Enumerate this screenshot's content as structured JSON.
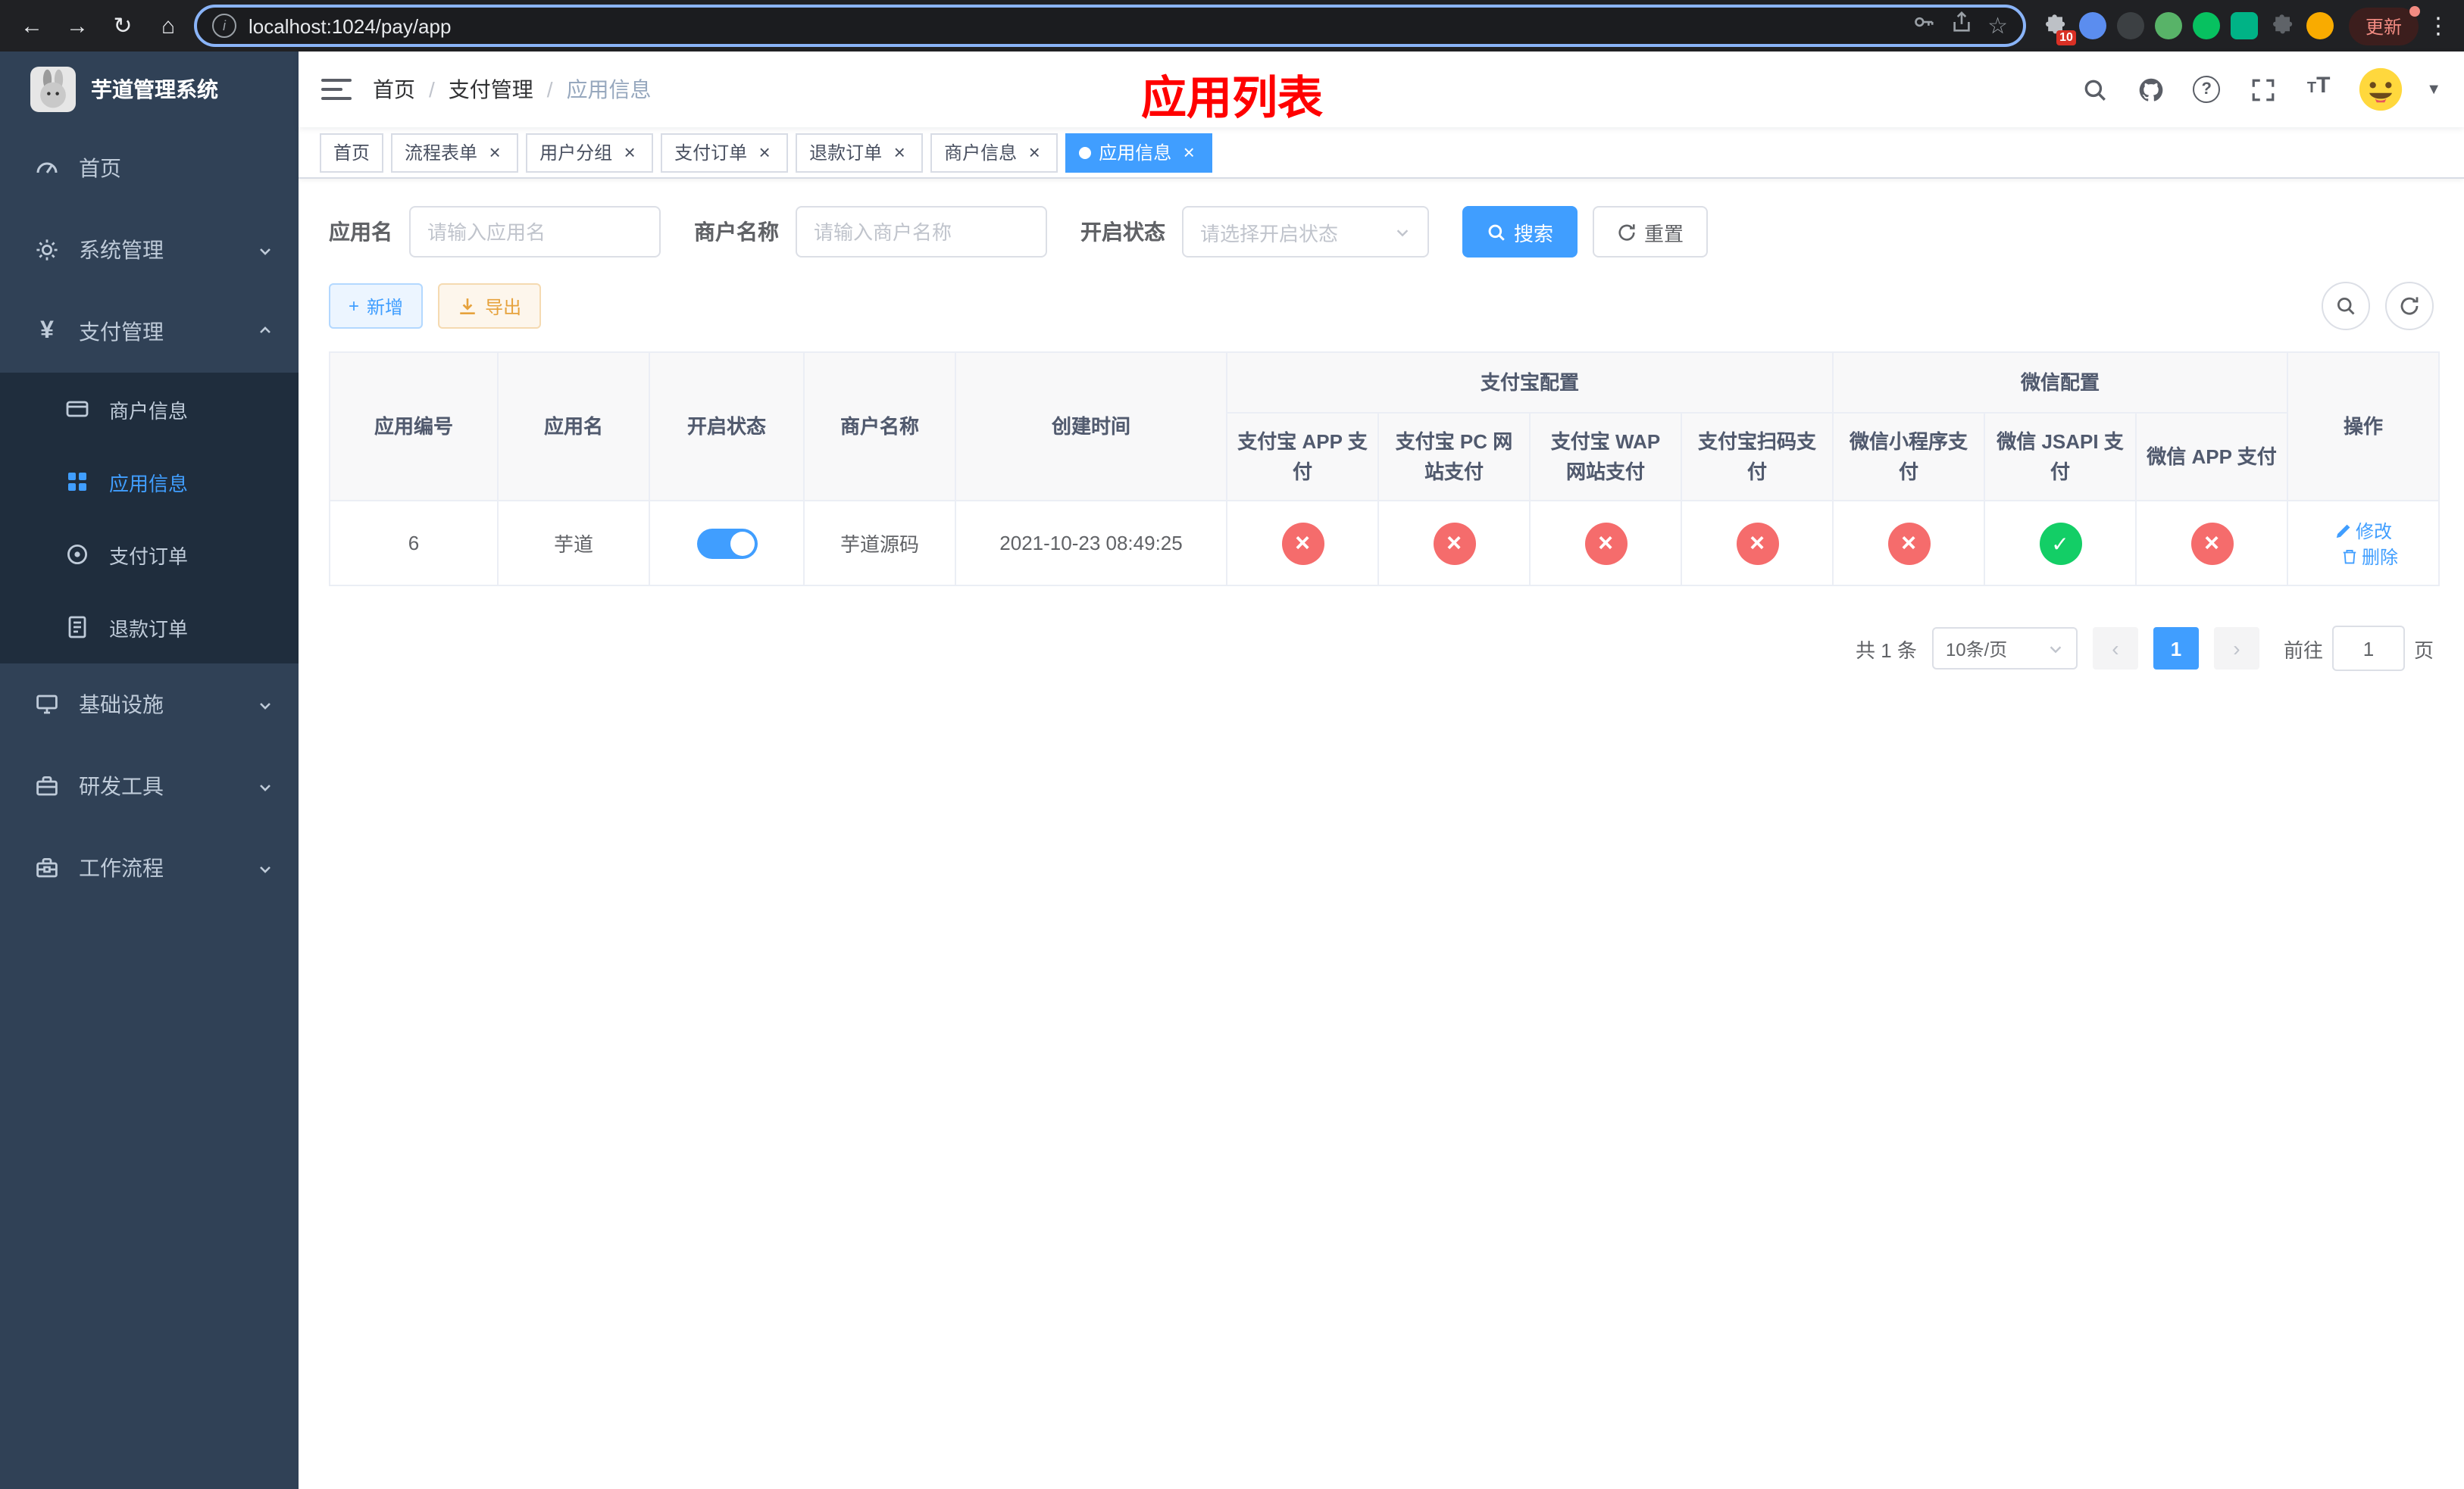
{
  "colors": {
    "accent": "#409eff",
    "danger": "#f56c6c",
    "success": "#13ce66",
    "warning": "#e6a23c",
    "page_title": "#ff0000",
    "sidebar_bg": "#304156"
  },
  "browser": {
    "url": "localhost:1024/pay/app",
    "update_label": "更新",
    "extensions_badge": "10"
  },
  "sidebar": {
    "title": "芋道管理系统",
    "home": "首页",
    "system": "系统管理",
    "payment": "支付管理",
    "merchant_info": "商户信息",
    "app_info": "应用信息",
    "pay_order": "支付订单",
    "refund_order": "退款订单",
    "infra": "基础设施",
    "dev_tools": "研发工具",
    "workflow": "工作流程"
  },
  "header": {
    "breadcrumb_home": "首页",
    "breadcrumb_payment": "支付管理",
    "breadcrumb_current": "应用信息",
    "page_title": "应用列表"
  },
  "tabs": [
    {
      "label": "首页"
    },
    {
      "label": "流程表单"
    },
    {
      "label": "用户分组"
    },
    {
      "label": "支付订单"
    },
    {
      "label": "退款订单"
    },
    {
      "label": "商户信息"
    },
    {
      "label": "应用信息"
    }
  ],
  "filters": {
    "app_name_label": "应用名",
    "app_name_placeholder": "请输入应用名",
    "merchant_label": "商户名称",
    "merchant_placeholder": "请输入商户名称",
    "status_label": "开启状态",
    "status_placeholder": "请选择开启状态",
    "search_label": "搜索",
    "reset_label": "重置"
  },
  "toolbar": {
    "add_label": "新增",
    "export_label": "导出"
  },
  "table": {
    "headers": {
      "app_id": "应用编号",
      "app_name": "应用名",
      "status": "开启状态",
      "merchant_name": "商户名称",
      "created_at": "创建时间",
      "alipay_group": "支付宝配置",
      "wechat_group": "微信配置",
      "alipay_app": "支付宝 APP 支付",
      "alipay_pc": "支付宝 PC 网站支付",
      "alipay_wap": "支付宝 WAP 网站支付",
      "alipay_qr": "支付宝扫码支付",
      "wechat_lite": "微信小程序支付",
      "wechat_jsapi": "微信 JSAPI 支付",
      "wechat_app": "微信 APP 支付",
      "actions": "操作"
    },
    "rows": [
      {
        "app_id": "6",
        "app_name": "芋道",
        "status": "on",
        "merchant_name": "芋道源码",
        "created_at": "2021-10-23 08:49:25",
        "alipay_app": "disabled",
        "alipay_pc": "disabled",
        "alipay_wap": "disabled",
        "alipay_qr": "disabled",
        "wechat_lite": "disabled",
        "wechat_jsapi": "enabled",
        "wechat_app": "disabled",
        "edit_label": "修改",
        "delete_label": "删除"
      }
    ]
  },
  "pagination": {
    "total": "共 1 条",
    "page_size": "10条/页",
    "current_page": "1",
    "goto_label": "前往",
    "goto_value": "1",
    "page_unit": "页"
  }
}
